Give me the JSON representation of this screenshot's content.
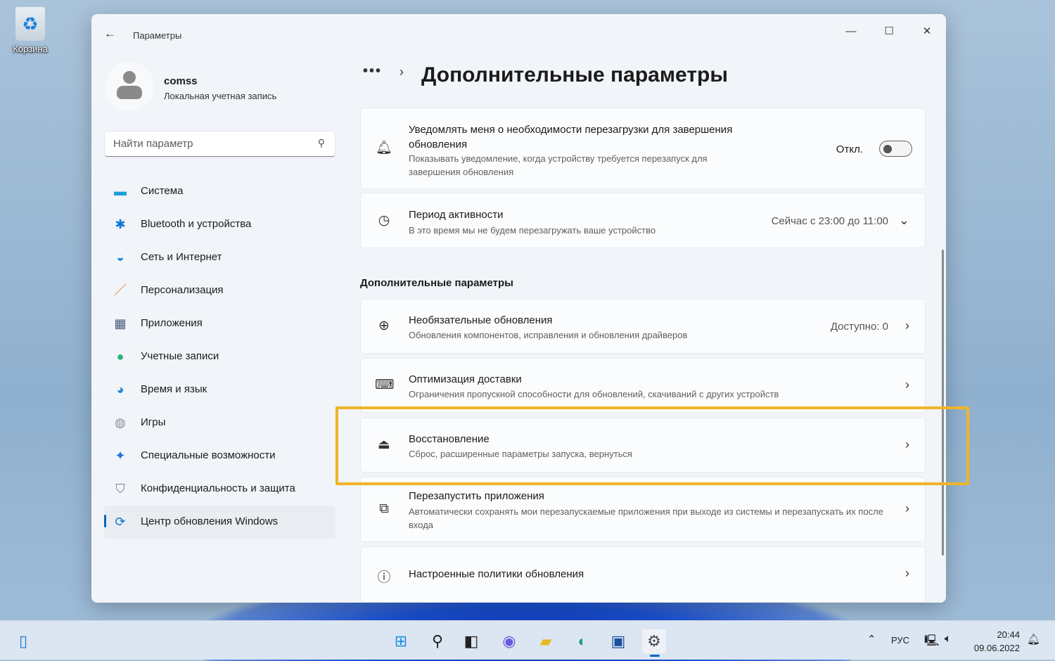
{
  "desktop": {
    "recycle_bin": "Корзина"
  },
  "window": {
    "title": "Параметры",
    "minimize": "—",
    "maximize": "☐",
    "close": "✕"
  },
  "user": {
    "name": "comss",
    "account_type": "Локальная учетная запись"
  },
  "search": {
    "placeholder": "Найти параметр"
  },
  "nav": [
    {
      "label": "Система",
      "icon": "display-icon",
      "glyph": "▬",
      "color": "#1a9fd9"
    },
    {
      "label": "Bluetooth и устройства",
      "icon": "bluetooth-icon",
      "glyph": "✱",
      "color": "#0a78d4"
    },
    {
      "label": "Сеть и Интернет",
      "icon": "wifi-icon",
      "glyph": "◒",
      "color": "#1a8fe0"
    },
    {
      "label": "Персонализация",
      "icon": "brush-icon",
      "glyph": "／",
      "color": "#e07a3a"
    },
    {
      "label": "Приложения",
      "icon": "apps-icon",
      "glyph": "▦",
      "color": "#4a5a7a"
    },
    {
      "label": "Учетные записи",
      "icon": "person-icon",
      "glyph": "●",
      "color": "#2bb37a"
    },
    {
      "label": "Время и язык",
      "icon": "globe-clock-icon",
      "glyph": "◕",
      "color": "#2a8ad8"
    },
    {
      "label": "Игры",
      "icon": "gamepad-icon",
      "glyph": "◍",
      "color": "#8a8f98"
    },
    {
      "label": "Специальные возможности",
      "icon": "accessibility-icon",
      "glyph": "✦",
      "color": "#1a78d4"
    },
    {
      "label": "Конфиденциальность и защита",
      "icon": "shield-icon",
      "glyph": "⛉",
      "color": "#7a7f88"
    },
    {
      "label": "Центр обновления Windows",
      "icon": "update-icon",
      "glyph": "⟳",
      "color": "#0a78d4"
    }
  ],
  "breadcrumb": {
    "more": "•••",
    "separator": "›",
    "title": "Дополнительные параметры"
  },
  "cards": {
    "notify": {
      "title": "Уведомлять меня о необходимости перезагрузки для завершения обновления",
      "desc": "Показывать уведомление, когда устройству требуется перезапуск для завершения обновления",
      "state": "Откл.",
      "toggle_on": false
    },
    "active_hours": {
      "title": "Период активности",
      "desc": "В это время мы не будем перезагружать ваше устройство",
      "value": "Сейчас с 23:00 до 11:00"
    },
    "section": "Дополнительные параметры",
    "optional": {
      "title": "Необязательные обновления",
      "desc": "Обновления компонентов, исправления и обновления драйверов",
      "value": "Доступно: 0"
    },
    "delivery": {
      "title": "Оптимизация доставки",
      "desc": "Ограничения пропускной способности для обновлений, скачиваний с других устройств"
    },
    "recovery": {
      "title": "Восстановление",
      "desc": "Сброс, расширенные параметры запуска, вернуться"
    },
    "restart_apps": {
      "title": "Перезапустить приложения",
      "desc": "Автоматически сохранять мои перезапускаемые приложения при выходе из системы и перезапускать их после входа"
    },
    "policies": {
      "title": "Настроенные политики обновления"
    }
  },
  "taskbar": {
    "lang": "РУС",
    "time": "20:44",
    "date": "09.06.2022"
  },
  "colors": {
    "highlight": "#f0b429",
    "accent": "#0067c0"
  }
}
